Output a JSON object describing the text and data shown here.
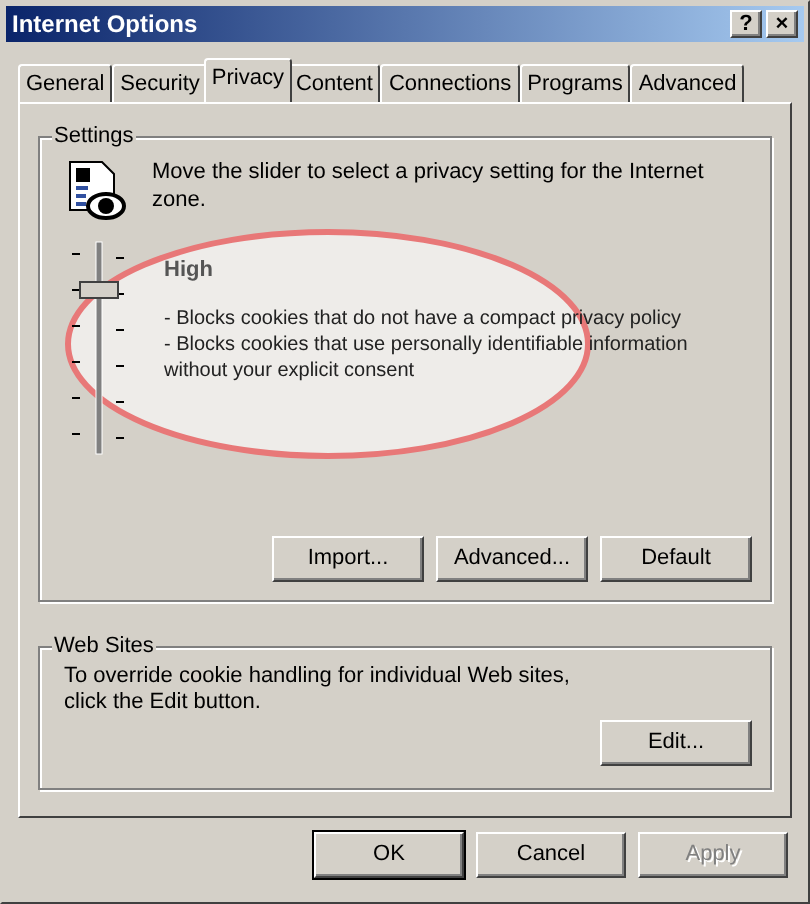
{
  "window": {
    "title": "Internet Options",
    "controls": [
      "?",
      "×"
    ]
  },
  "tabs": [
    {
      "label": "General",
      "selected": false
    },
    {
      "label": "Security",
      "selected": false
    },
    {
      "label": "Privacy",
      "selected": true
    },
    {
      "label": "Content",
      "selected": false
    },
    {
      "label": "Connections",
      "selected": false
    },
    {
      "label": "Programs",
      "selected": false
    },
    {
      "label": "Advanced",
      "selected": false
    }
  ],
  "settings": {
    "title": "Settings",
    "intro": "Move the slider to select a privacy setting for the Internet zone.",
    "slider": {
      "level": 0.8
    },
    "level_name": "High",
    "description_lines": [
      "- Blocks cookies that do not have a compact privacy policy",
      "- Blocks cookies that use personally identifiable information",
      "without your explicit consent"
    ],
    "buttons": [
      {
        "label": "Import..."
      },
      {
        "label": "Advanced..."
      },
      {
        "label": "Default"
      }
    ]
  },
  "web_sites": {
    "title": "Web Sites",
    "text_lines": [
      "To override cookie handling for individual Web sites,",
      "click the Edit button."
    ],
    "button": "Edit..."
  },
  "dialog_buttons": [
    {
      "label": "OK",
      "default": true,
      "disabled": false
    },
    {
      "label": "Cancel",
      "default": false,
      "disabled": false
    },
    {
      "label": "Apply",
      "default": false,
      "disabled": true
    }
  ]
}
